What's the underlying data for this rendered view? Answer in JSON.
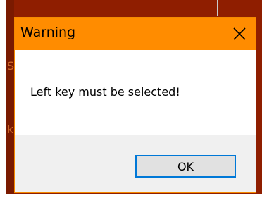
{
  "dialog": {
    "title": "Warning",
    "message": "Left key must be selected!",
    "ok_label": "OK",
    "close_icon": "close-icon"
  },
  "background": {
    "chars": [
      "S",
      "k"
    ]
  },
  "colors": {
    "titlebar": "#ff8c00",
    "background_window": "#8f1e00",
    "ok_border": "#0078d7"
  }
}
